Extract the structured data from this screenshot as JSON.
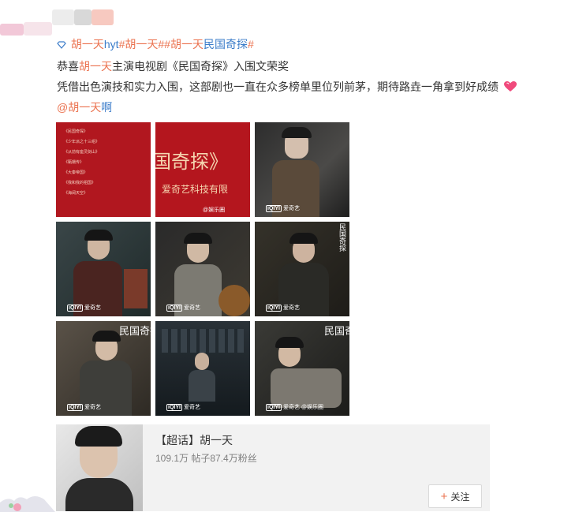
{
  "post": {
    "tag_line": [
      {
        "text": "胡一天",
        "style": "link",
        "icon": "diamond-icon"
      },
      {
        "text": "hyt",
        "style": "blue"
      },
      {
        "text": "#胡一天#",
        "style": "link"
      },
      {
        "text": "#胡一天",
        "style": "link"
      },
      {
        "text": "民国奇探",
        "style": "blue"
      },
      {
        "text": "#",
        "style": "link"
      }
    ],
    "line2": [
      {
        "text": "恭喜",
        "style": "dark"
      },
      {
        "text": "胡一天",
        "style": "link"
      },
      {
        "text": "主演电视剧《民国奇探》入围文荣奖",
        "style": "dark"
      }
    ],
    "line3": "凭借出色演技和实力入围，这部剧也一直在众多榜单里位列前茅，期待路垚一角拿到好成绩",
    "line4": [
      {
        "text": "@胡一天",
        "style": "link"
      },
      {
        "text": "啊",
        "style": "link"
      }
    ],
    "heart_icon": "heart-icon"
  },
  "images": {
    "doc_lines": [
      "《民国奇探》",
      "《少年派之十三组》",
      "《从前有座灵剑山》",
      "《甄嬛传》",
      "《大秦帝国》",
      "《我和我的祖国》",
      "《海阔天空》"
    ],
    "banner_text": "国奇探》",
    "banner_sub": "爱奇艺科技有限",
    "wm_brand": "iQIYI",
    "wm_label": "爱奇艺",
    "wm_source": "@娱乐圈",
    "poster_title": "民国奇探"
  },
  "card": {
    "title": "【超话】胡一天",
    "stats": "109.1万 帖子87.4万粉丝",
    "follow_label": "关注",
    "follow_icon": "plus-icon"
  },
  "colors": {
    "link": "#eb7350",
    "blue": "#3b7cc9",
    "text": "#333333",
    "banner_red": "#b4161e"
  }
}
